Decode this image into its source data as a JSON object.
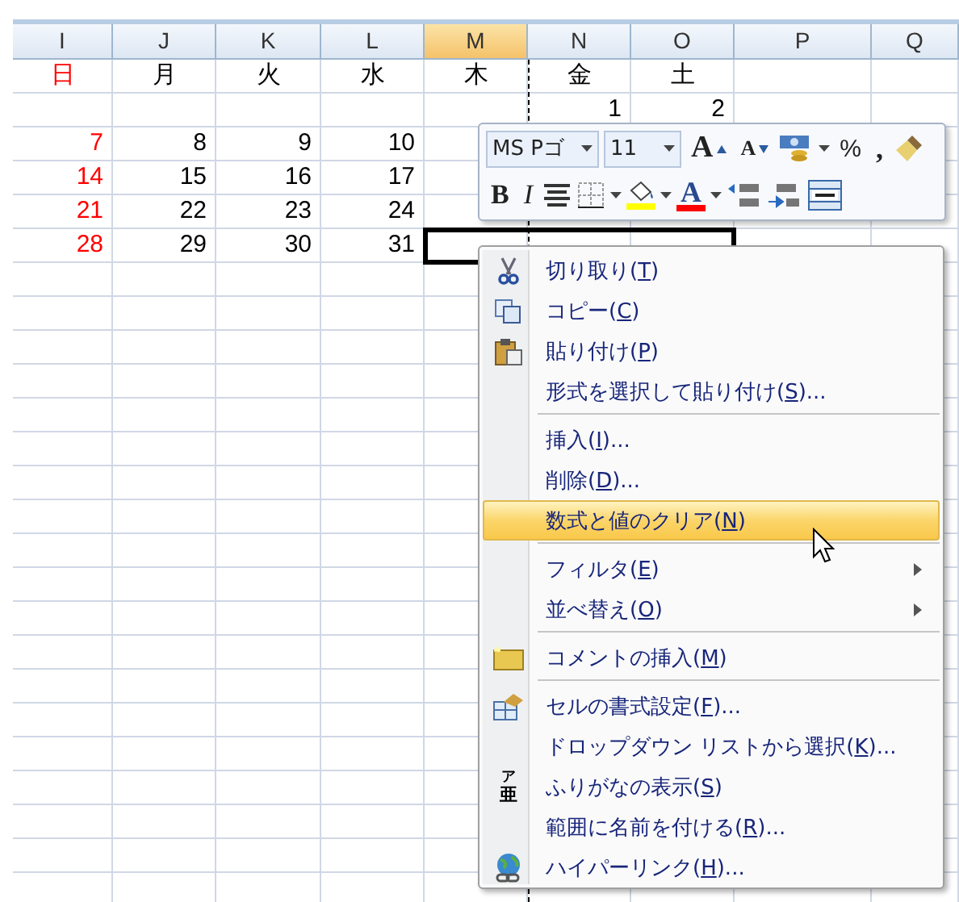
{
  "columns": [
    {
      "letter": "I",
      "selected": false,
      "holiday": true,
      "cells": [
        "日",
        null,
        "7",
        "14",
        "21",
        "28"
      ]
    },
    {
      "letter": "J",
      "selected": false,
      "holiday": false,
      "cells": [
        "月",
        null,
        "8",
        "15",
        "22",
        "29"
      ]
    },
    {
      "letter": "K",
      "selected": false,
      "holiday": false,
      "cells": [
        "火",
        null,
        "9",
        "16",
        "23",
        "30"
      ]
    },
    {
      "letter": "L",
      "selected": false,
      "holiday": false,
      "cells": [
        "水",
        null,
        "10",
        "17",
        "24",
        "31"
      ]
    },
    {
      "letter": "M",
      "selected": true,
      "holiday": false,
      "cells": [
        "木"
      ]
    },
    {
      "letter": "N",
      "selected": false,
      "holiday": false,
      "cells": [
        "金",
        "1"
      ]
    },
    {
      "letter": "O",
      "selected": false,
      "holiday": false,
      "cells": [
        "土",
        "2"
      ]
    },
    {
      "letter": "P",
      "selected": false
    },
    {
      "letter": "Q",
      "selected": false
    }
  ],
  "mini_toolbar": {
    "top_row": [
      {
        "kind": "font",
        "value": "MS Pゴ"
      },
      {
        "kind": "size",
        "value": "11"
      },
      {
        "kind": "grow",
        "text": "A"
      },
      {
        "kind": "shrink",
        "text": "A"
      },
      {
        "kind": "currency"
      },
      {
        "kind": "percent",
        "text": "%"
      },
      {
        "kind": "comma",
        "text": ","
      },
      {
        "kind": "painter"
      }
    ],
    "bottom_row": [
      {
        "kind": "bold",
        "text": "B"
      },
      {
        "kind": "italic",
        "text": "I"
      },
      {
        "kind": "center"
      },
      {
        "kind": "borders"
      },
      {
        "kind": "fill",
        "color": "#ffff00"
      },
      {
        "kind": "fontcolor",
        "text": "A",
        "color": "#ff0000"
      },
      {
        "kind": "incdec"
      },
      {
        "kind": "decdec"
      },
      {
        "kind": "merge"
      }
    ]
  },
  "context_menu": {
    "items": [
      {
        "kind": "cut",
        "before": "切り取り(",
        "key": "T",
        "after": ")",
        "selected": false,
        "submenu": false
      },
      {
        "kind": "copy",
        "before": "コピー(",
        "key": "C",
        "after": ")",
        "selected": false,
        "submenu": false
      },
      {
        "kind": "paste",
        "before": "貼り付け(",
        "key": "P",
        "after": ")",
        "selected": false,
        "submenu": false
      },
      {
        "kind": "plain",
        "before": "形式を選択して貼り付け(",
        "key": "S",
        "after": ")...",
        "selected": false,
        "submenu": false
      },
      {
        "kind": "separator"
      },
      {
        "kind": "plain",
        "before": "挿入(",
        "key": "I",
        "after": ")...",
        "selected": false,
        "submenu": false
      },
      {
        "kind": "plain",
        "before": "削除(",
        "key": "D",
        "after": ")...",
        "selected": false,
        "submenu": false
      },
      {
        "kind": "plain",
        "before": "数式と値のクリア(",
        "key": "N",
        "after": ")",
        "selected": true,
        "submenu": false
      },
      {
        "kind": "separator"
      },
      {
        "kind": "plain",
        "before": "フィルタ(",
        "key": "E",
        "after": ")",
        "selected": false,
        "submenu": true
      },
      {
        "kind": "plain",
        "before": "並べ替え(",
        "key": "O",
        "after": ")",
        "selected": false,
        "submenu": true
      },
      {
        "kind": "separator"
      },
      {
        "kind": "comment",
        "before": "コメントの挿入(",
        "key": "M",
        "after": ")",
        "selected": false,
        "submenu": false
      },
      {
        "kind": "separator"
      },
      {
        "kind": "format",
        "before": "セルの書式設定(",
        "key": "F",
        "after": ")...",
        "selected": false,
        "submenu": false
      },
      {
        "kind": "plain",
        "before": "ドロップダウン リストから選択(",
        "key": "K",
        "after": ")...",
        "selected": false,
        "submenu": false
      },
      {
        "kind": "phonetic",
        "glyph_top": "ア",
        "glyph_main": "亜",
        "before": "ふりがなの表示(",
        "key": "S",
        "after": ")",
        "selected": false,
        "submenu": false
      },
      {
        "kind": "plain",
        "before": "範囲に名前を付ける(",
        "key": "R",
        "after": ")...",
        "selected": false,
        "submenu": false
      },
      {
        "kind": "link",
        "before": "ハイパーリンク(",
        "key": "H",
        "after": ")...",
        "selected": false,
        "submenu": false
      }
    ]
  }
}
